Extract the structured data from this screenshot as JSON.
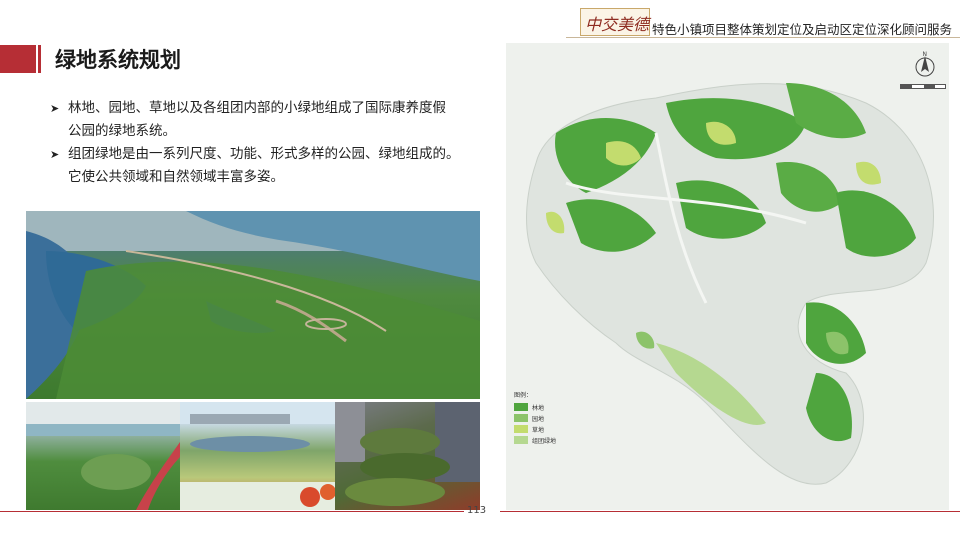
{
  "header": {
    "brand_logo_text": "中交美德",
    "brand_title": "特色小镇项目整体策划定位及启动区定位深化顾问服务"
  },
  "slide": {
    "title": "绿地系统规划",
    "bullets": [
      {
        "lines": [
          "林地、园地、草地以及各组团内部的小绿地组成了国际康养度假",
          "公园的绿地系统。"
        ]
      },
      {
        "lines": [
          "组团绿地是由一系列尺度、功能、形式多样的公园、绿地组成的。",
          "它使公共领域和自然领域丰富多姿。"
        ]
      }
    ]
  },
  "map": {
    "compass_label": "N",
    "legend": {
      "title": "图例：",
      "items": [
        {
          "label": "林地",
          "color": "#4fa53e"
        },
        {
          "label": "园地",
          "color": "#8cc36a"
        },
        {
          "label": "草地",
          "color": "#c3dc6e"
        },
        {
          "label": "组团绿地",
          "color": "#b5d890"
        }
      ]
    }
  },
  "footer": {
    "page_number": "113"
  },
  "colors": {
    "accent_red": "#b62e35",
    "forest": "#4fa53e",
    "garden": "#8cc36a",
    "grass": "#c3dc6e"
  }
}
